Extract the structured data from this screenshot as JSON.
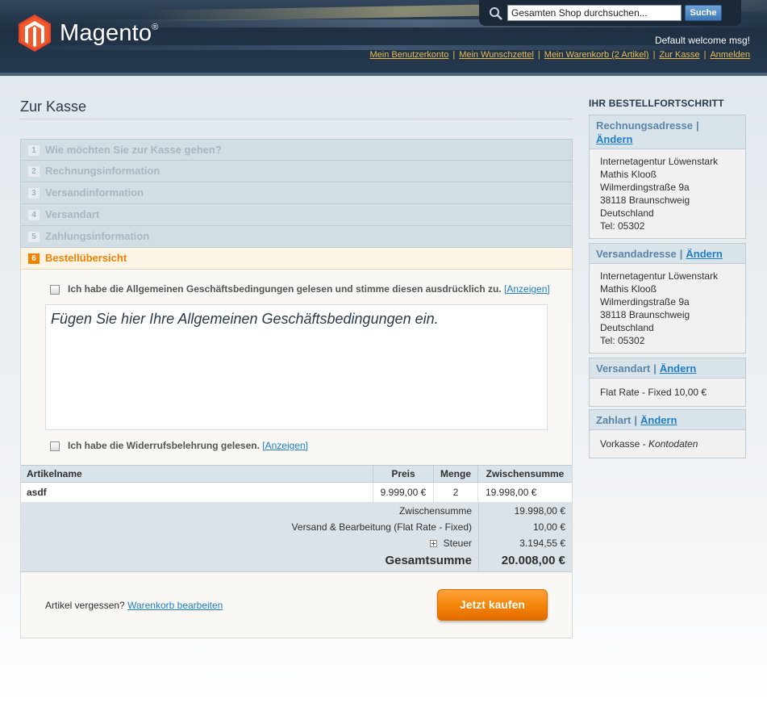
{
  "header": {
    "logo_text": "Magento",
    "logo_reg": "®",
    "search_placeholder": "Gesamten Shop durchsuchen...",
    "search_value": "Gesamten Shop durchsuchen...",
    "search_button": "Suche",
    "welcome": "Default welcome msg!",
    "links": [
      "Mein Benutzerkonto",
      "Mein Wunschzettel",
      "Mein Warenkorb (2 Artikel)",
      "Zur Kasse",
      "Anmelden"
    ],
    "separator": "|"
  },
  "checkout": {
    "title": "Zur Kasse",
    "steps": [
      {
        "num": "1",
        "label": "Wie möchten Sie zur Kasse gehen?"
      },
      {
        "num": "2",
        "label": "Rechnungsinformation"
      },
      {
        "num": "3",
        "label": "Versandinformation"
      },
      {
        "num": "4",
        "label": "Versandart"
      },
      {
        "num": "5",
        "label": "Zahlungsinformation"
      },
      {
        "num": "6",
        "label": "Bestellübersicht"
      }
    ],
    "agreement1_text": "Ich habe die Allgemeinen Geschäftsbedingungen gelesen und stimme diesen ausdrücklich zu.",
    "agreement1_link": "[Anzeigen]",
    "terms_content": "Fügen Sie hier Ihre Allgemeinen Geschäftsbedingungen ein.",
    "agreement2_text": "Ich habe die Widerrufsbelehrung gelesen.",
    "agreement2_link": "[Anzeigen]",
    "table": {
      "headers": [
        "Artikelname",
        "Preis",
        "Menge",
        "Zwischensumme"
      ],
      "rows": [
        {
          "name": "asdf",
          "price": "9.999,00 €",
          "qty": "2",
          "subtotal": "19.998,00 €"
        }
      ]
    },
    "totals": {
      "subtotal_label": "Zwischensumme",
      "subtotal_value": "19.998,00 €",
      "shipping_label": "Versand & Bearbeitung (Flat Rate - Fixed)",
      "shipping_value": "10,00 €",
      "tax_label": "Steuer",
      "tax_value": "3.194,55 €",
      "grand_label": "Gesamtsumme",
      "grand_value": "20.008,00 €"
    },
    "forgot_text": "Artikel vergessen?",
    "forgot_link": "Warenkorb bearbeiten",
    "buy_button": "Jetzt kaufen"
  },
  "sidebar": {
    "title": "IHR BESTELLFORTSCHRITT",
    "edit_label": "Ändern",
    "billing": {
      "title": "Rechnungsadresse",
      "lines": [
        "Internetagentur Löwenstark",
        "Mathis Klooß",
        "Wilmerdingstraße 9a",
        "38118 Braunschweig",
        "Deutschland",
        "Tel: 05302"
      ]
    },
    "shipping": {
      "title": "Versandadresse",
      "lines": [
        "Internetagentur Löwenstark",
        "Mathis Klooß",
        "Wilmerdingstraße 9a",
        "38118 Braunschweig",
        "Deutschland",
        "Tel: 05302"
      ]
    },
    "shipping_method": {
      "title": "Versandart",
      "value": "Flat Rate - Fixed 10,00 €"
    },
    "payment": {
      "title": "Zahlart",
      "value": "Vorkasse",
      "value_sep": " - ",
      "value_italic": "Kontodaten"
    }
  },
  "colors": {
    "accent_orange": "#f18200",
    "link_blue": "#1e7ec8",
    "header_link": "#ebbc4e",
    "header_bg": "#1f3043"
  }
}
